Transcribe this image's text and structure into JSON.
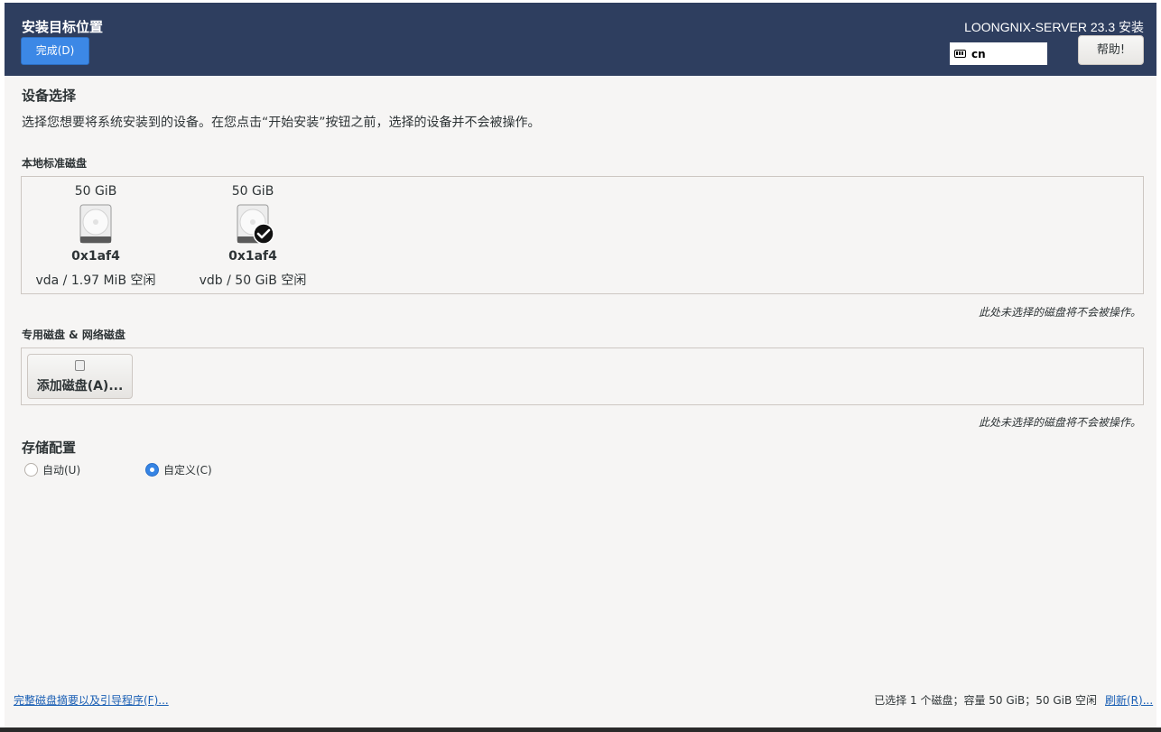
{
  "header": {
    "title": "安装目标位置",
    "done_label": "完成(D)",
    "product": "LOONGNIX-SERVER 23.3 安装",
    "keyboard_layout": "cn",
    "help_label": "帮助!"
  },
  "device_selection": {
    "title": "设备选择",
    "description": "选择您想要将系统安装到的设备。在您点击“开始安装”按钮之前，选择的设备并不会被操作。"
  },
  "local_disks": {
    "label": "本地标准磁盘",
    "disks": [
      {
        "size": "50 GiB",
        "name": "0x1af4",
        "info": "vda  /  1.97 MiB 空闲",
        "selected": false
      },
      {
        "size": "50 GiB",
        "name": "0x1af4",
        "info": "vdb  /  50 GiB 空闲",
        "selected": true
      }
    ],
    "note": "此处未选择的磁盘将不会被操作。"
  },
  "special_disks": {
    "label": "专用磁盘 & 网络磁盘",
    "add_label": "添加磁盘(A)...",
    "note": "此处未选择的磁盘将不会被操作。"
  },
  "storage_config": {
    "title": "存储配置",
    "options": [
      {
        "label": "自动(U)",
        "selected": false
      },
      {
        "label": "自定义(C)",
        "selected": true
      }
    ]
  },
  "footer": {
    "summary_link": "完整磁盘摘要以及引导程序(F)...",
    "summary": "已选择 1 个磁盘；容量 50 GiB；50 GiB 空闲",
    "refresh_link": "刷新(R)..."
  },
  "colors": {
    "header_bg": "#2e3e5f",
    "accent": "#3c88e6",
    "window_bg": "#f6f5f4"
  }
}
